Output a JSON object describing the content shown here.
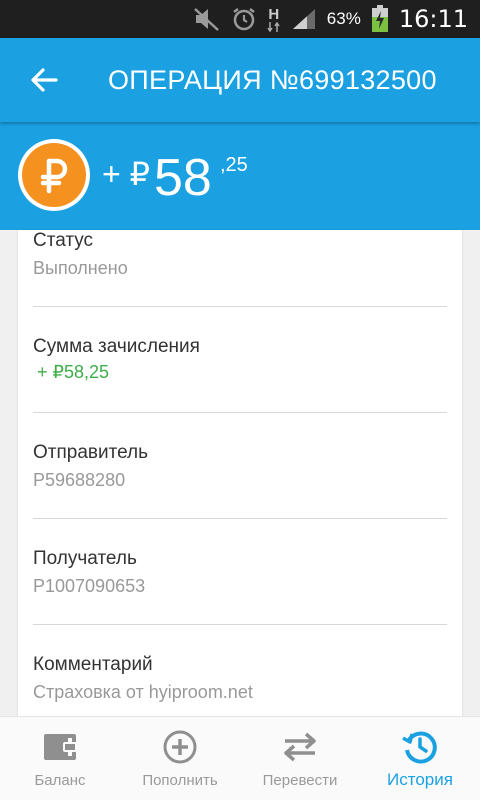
{
  "status_bar": {
    "battery_percent": "63%",
    "network_label": "H",
    "time": "16:11"
  },
  "appbar": {
    "title": "ОПЕРАЦИЯ №699132500"
  },
  "amount": {
    "sign": "+ ₽",
    "main": "58",
    "fraction": ",25"
  },
  "details": [
    {
      "label": "Статус",
      "value": "Выполнено",
      "value_color": "gray"
    },
    {
      "label": "Сумма зачисления",
      "value": "+ ₽58,25",
      "value_color": "green"
    },
    {
      "label": "Отправитель",
      "value": "P59688280",
      "value_color": "gray"
    },
    {
      "label": "Получатель",
      "value": "P1007090653",
      "value_color": "gray"
    },
    {
      "label": "Комментарий",
      "value": "Страховка от hyiproom.net",
      "value_color": "gray"
    }
  ],
  "bottom_nav": [
    {
      "label": "Баланс",
      "icon": "wallet-icon",
      "active": false
    },
    {
      "label": "Пополнить",
      "icon": "add-circle-icon",
      "active": false
    },
    {
      "label": "Перевести",
      "icon": "transfer-icon",
      "active": false
    },
    {
      "label": "История",
      "icon": "history-icon",
      "active": true
    }
  ],
  "colors": {
    "primary": "#1ba1e2",
    "coin": "#f5911e",
    "positive": "#3fae49",
    "status_bar": "#1f1f1f"
  }
}
